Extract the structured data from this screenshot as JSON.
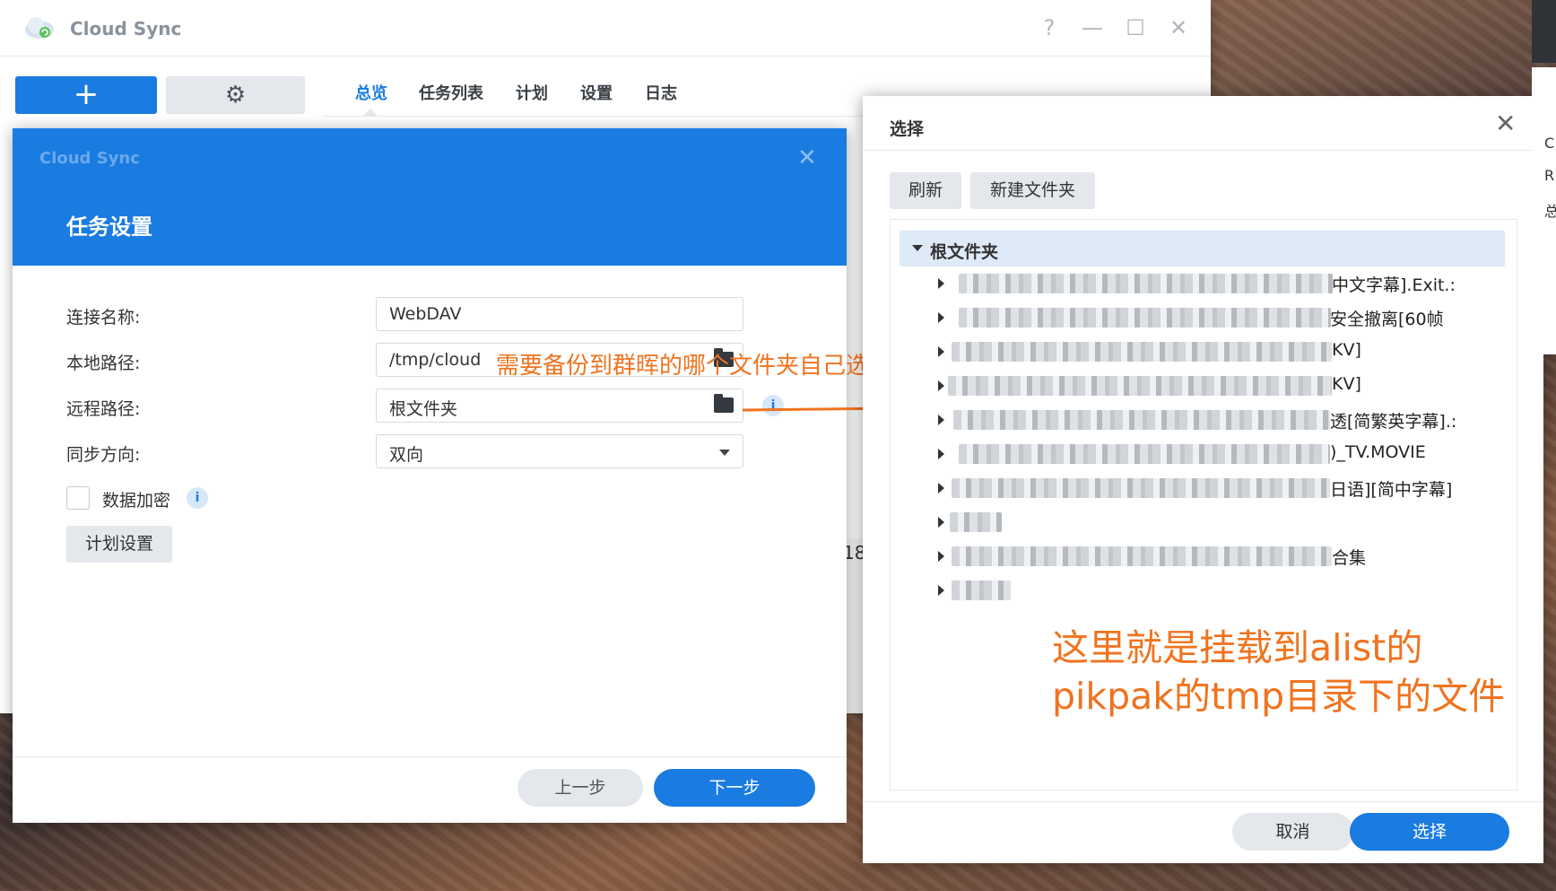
{
  "main_window": {
    "title": "Cloud Sync",
    "controls": {
      "help": "?",
      "minimize": "—",
      "maximize": "☐",
      "close": "✕"
    },
    "add_label": "+",
    "settings_icon": "⚙",
    "tabs": [
      {
        "label": "总览",
        "active": true
      },
      {
        "label": "任务列表"
      },
      {
        "label": "计划"
      },
      {
        "label": "设置"
      },
      {
        "label": "日志"
      }
    ],
    "partial_number": "18"
  },
  "task_dialog": {
    "app_name": "Cloud Sync",
    "close": "✕",
    "title": "任务设置",
    "fields": {
      "connection_name": {
        "label": "连接名称:",
        "value": "WebDAV"
      },
      "local_path": {
        "label": "本地路径:",
        "value": "/tmp/cloud"
      },
      "remote_path": {
        "label": "远程路径:",
        "value": "根文件夹"
      },
      "sync_direction": {
        "label": "同步方向:",
        "value": "双向"
      }
    },
    "encrypt_label": "数据加密",
    "info_glyph": "i",
    "schedule_button": "计划设置",
    "prev_button": "上一步",
    "next_button": "下一步"
  },
  "annotations": {
    "local_path_note": "需要备份到群晖的哪个文件夹自己选择",
    "tree_note_line1": "这里就是挂载到alist的",
    "tree_note_line2": "pikpak的tmp目录下的文件",
    "color": "#f0731e"
  },
  "select_dialog": {
    "title": "选择",
    "close": "✕",
    "refresh_button": "刷新",
    "new_folder_button": "新建文件夹",
    "root_label": "根文件夹",
    "items": [
      {
        "visible_suffix": "中文字幕].Exit.:"
      },
      {
        "visible_suffix": "安全撤离[60帧"
      },
      {
        "visible_suffix": "KV]"
      },
      {
        "visible_suffix": "KV]"
      },
      {
        "visible_suffix": "透[简繁英字幕].:"
      },
      {
        "visible_suffix": ")_TV.MOVIE"
      },
      {
        "visible_suffix": "日语][简中字幕]"
      },
      {
        "visible_suffix": ""
      },
      {
        "visible_suffix": "合集"
      },
      {
        "visible_suffix": ""
      }
    ],
    "cancel_button": "取消",
    "select_button": "选择"
  },
  "edge_window": {
    "chars": [
      "C",
      "R",
      "总"
    ]
  },
  "colors": {
    "accent": "#1a7be0",
    "annotation": "#f0731e"
  }
}
